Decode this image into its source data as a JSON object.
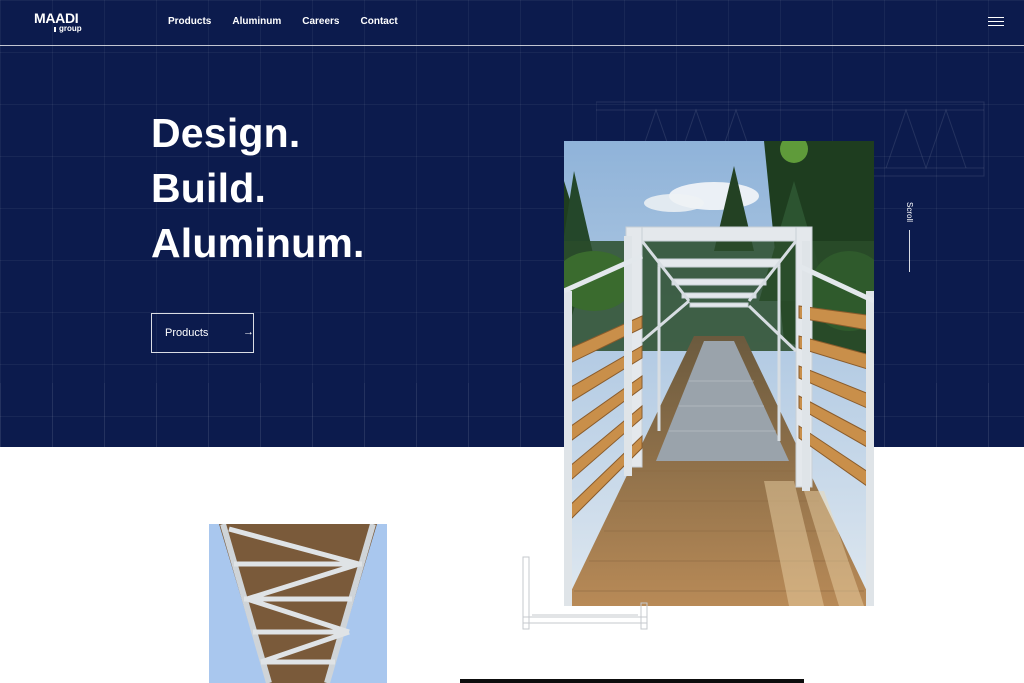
{
  "brand": {
    "name": "MAADI",
    "sub": "group"
  },
  "nav": {
    "items": [
      "Products",
      "Aluminum",
      "Careers",
      "Contact"
    ]
  },
  "hero": {
    "headline": [
      "Design.",
      "Build.",
      "Aluminum."
    ],
    "cta_label": "Products",
    "cta_arrow": "→",
    "scroll_label": "Scroll"
  },
  "colors": {
    "navy": "#0c1b4d",
    "white": "#ffffff"
  },
  "icons": {
    "menu": "hamburger-menu-icon",
    "arrow": "arrow-right-icon"
  }
}
